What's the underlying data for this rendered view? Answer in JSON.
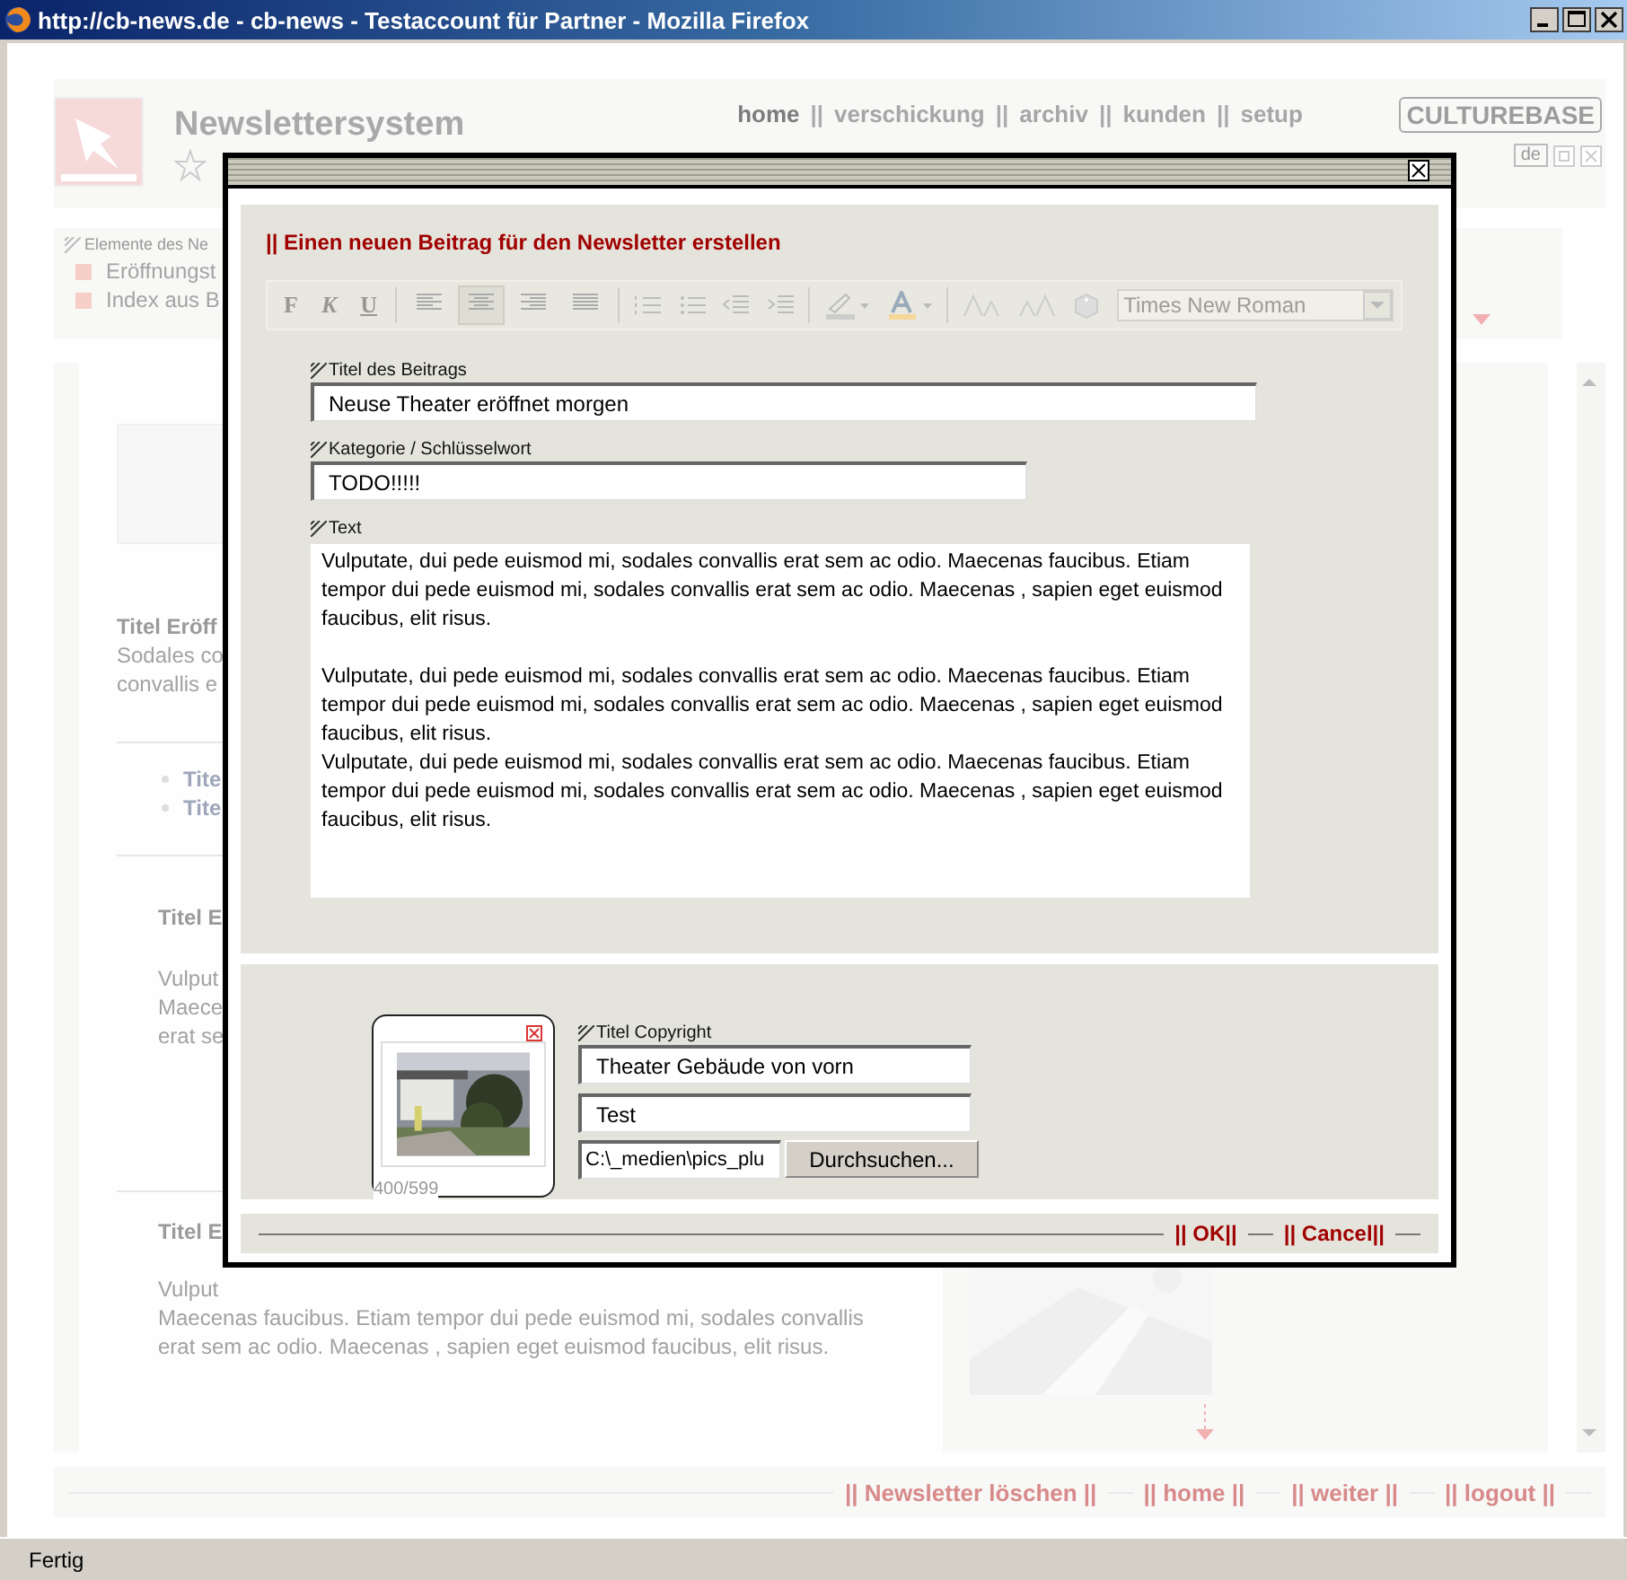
{
  "window": {
    "title": "http://cb-news.de - cb-news - Testaccount für Partner - Mozilla Firefox"
  },
  "header": {
    "app_title": "Newslettersystem",
    "brand": "CULTUREBASE",
    "language": "de",
    "nav": [
      {
        "label": "home",
        "selected": true
      },
      {
        "label": "verschickung",
        "selected": false,
        "separator": "||"
      },
      {
        "label": "archiv",
        "selected": false,
        "separator": "||"
      },
      {
        "label": "kunden",
        "selected": false,
        "separator": "||"
      },
      {
        "label": "setup",
        "selected": false,
        "separator": "||"
      }
    ]
  },
  "elements_panel": {
    "title": "Elemente des Ne",
    "items": [
      "Eröffnungst",
      "Index aus B"
    ]
  },
  "content": {
    "sections": [
      {
        "kind": "lead",
        "title": "Titel Eröff",
        "lines": [
          "Sodales co",
          "convallis e"
        ],
        "bullets": [
          "Tite",
          "Tite"
        ]
      },
      {
        "kind": "entry",
        "title": "Titel E",
        "lines": [
          "Vulput",
          "Maece",
          "erat se"
        ]
      },
      {
        "kind": "entry",
        "title": "Titel E",
        "lines": [
          "Vulput",
          "Maecenas faucibus. Etiam tempor dui pede euismod mi, sodales convallis",
          "erat sem ac odio. Maecenas , sapien eget euismod faucibus, elit risus."
        ]
      }
    ]
  },
  "footer_nav": [
    "|| Newsletter löschen ||",
    "|| home ||",
    "|| weiter ||",
    "|| logout ||"
  ],
  "dialog": {
    "heading": "|| Einen neuen Beitrag für den Newsletter erstellen",
    "toolbar": {
      "format_buttons": [
        "F",
        "K",
        "U"
      ],
      "align": [
        {
          "selected": false
        },
        {
          "selected": true
        },
        {
          "selected": false
        },
        {
          "selected": false
        }
      ],
      "font": "Times New Roman"
    },
    "fields": [
      {
        "label": "Titel des Beitrags",
        "value": "Neuse Theater eröffnet morgen"
      },
      {
        "label": "Kategorie / Schlüsselwort",
        "value": "TODO!!!!!"
      }
    ],
    "text": {
      "label": "Text",
      "blocks": [
        [
          "Vulputate, dui pede euismod mi, sodales convallis erat sem ac odio. Maecenas faucibus. Etiam tempor dui pede euismod mi, sodales convallis erat sem ac odio. Maecenas , sapien eget euismod faucibus, elit risus."
        ],
        [
          "Vulputate, dui pede euismod mi, sodales convallis erat sem ac odio. Maecenas faucibus. Etiam tempor dui pede euismod mi, sodales convallis erat sem ac odio. Maecenas , sapien eget euismod faucibus, elit risus.",
          "Vulputate, dui pede euismod mi, sodales convallis erat sem ac odio. Maecenas faucibus. Etiam tempor dui pede euismod mi, sodales convallis erat sem ac odio. Maecenas , sapien eget euismod faucibus, elit risus."
        ]
      ]
    },
    "media": {
      "size": "400/599",
      "copyright_label": "Titel Copyright",
      "title_value": "Theater Gebäude von vorn",
      "copyright_value": "Test",
      "file_value": "C:\\_medien\\pics_plu",
      "browse_button": "Durchsuchen..."
    },
    "buttons": [
      "|| OK||",
      "|| Cancel||"
    ]
  },
  "status_bar": {
    "text": "Fertig"
  }
}
